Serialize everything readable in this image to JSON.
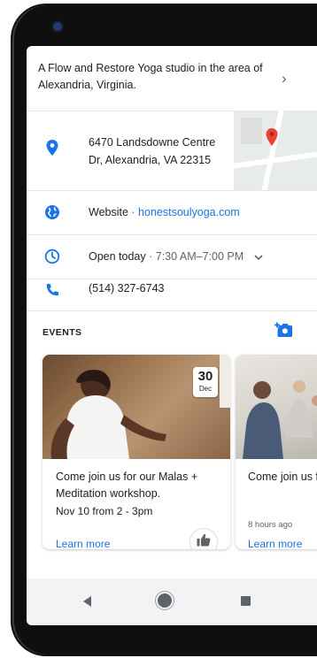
{
  "business": {
    "description": "A Flow and Restore Yoga studio in the area of Alexandria, Virginia.",
    "address_line1": "6470 Landsdowne Centre",
    "address_line2": "Dr, Alexandria, VA 22315",
    "website_label": "Website",
    "website_sep": " · ",
    "website_url": "honestsoulyoga.com",
    "hours_status": "Open today",
    "hours_sep": " · ",
    "hours_range": "7:30 AM–7:00 PM",
    "phone": "(514) 327-6743"
  },
  "events": {
    "heading": "EVENTS",
    "cards": [
      {
        "date_day": "30",
        "date_month": "Dec",
        "title": "Come join us for our Malas + Meditation workshop.",
        "subtitle": "Nov 10 from 2 - 3pm",
        "learn_more": "Learn more"
      },
      {
        "title": "Come join us for our Malas + Meditation workshop.",
        "time_ago": "8 hours ago",
        "learn_more": "Learn more"
      }
    ]
  },
  "icons": {
    "location": "location-pin-icon",
    "web": "globe-icon",
    "hours": "clock-icon",
    "phone": "phone-icon",
    "add_photo": "add-photo-icon",
    "like": "thumbs-up-icon"
  },
  "colors": {
    "accent": "#1a73e8",
    "map_pin": "#ea4335",
    "text": "#202124",
    "muted": "#5f6368"
  }
}
